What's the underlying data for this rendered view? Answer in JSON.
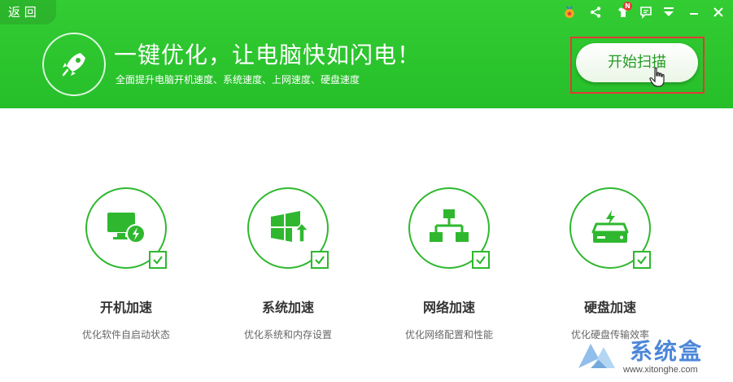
{
  "header": {
    "back_label": "返 回",
    "headline": "一键优化，让电脑快如闪电！",
    "subline": "全面提升电脑开机速度、系统速度、上网速度、硬盘速度",
    "scan_button": "开始扫描",
    "notification_badge": "N"
  },
  "features": [
    {
      "title": "开机加速",
      "desc": "优化软件自启动状态",
      "icon": "monitor-bolt-icon"
    },
    {
      "title": "系统加速",
      "desc": "优化系统和内存设置",
      "icon": "windows-up-icon"
    },
    {
      "title": "网络加速",
      "desc": "优化网络配置和性能",
      "icon": "network-icon"
    },
    {
      "title": "硬盘加速",
      "desc": "优化硬盘传输效率",
      "icon": "harddisk-bolt-icon"
    }
  ],
  "watermark": {
    "text": "系统盒",
    "url": "www.xitonghe.com"
  },
  "colors": {
    "brand_green": "#2fb82f",
    "header_green": "#33cc33",
    "highlight_red": "#e53935"
  }
}
